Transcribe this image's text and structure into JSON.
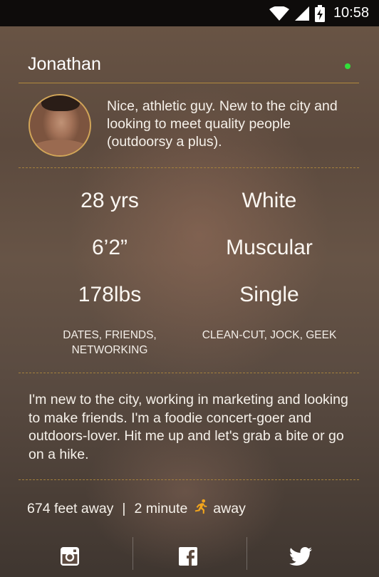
{
  "status_bar": {
    "time": "10:58"
  },
  "profile": {
    "name": "Jonathan",
    "online": true,
    "short_bio": "Nice, athletic guy.  New to the city and looking to meet quality people (outdoorsy a plus)."
  },
  "stats": {
    "age": "28 yrs",
    "ethnicity": "White",
    "height": "6’2”",
    "body_type": "Muscular",
    "weight": "178lbs",
    "relationship": "Single",
    "looking_for": "DATES, FRIENDS, NETWORKING",
    "tribes": "CLEAN-CUT, JOCK, GEEK"
  },
  "about": "I'm new to the city, working in marketing and looking to make friends.  I'm a foodie concert-goer and outdoors-lover.  Hit me up and let's grab a bite or go on a hike.",
  "distance": {
    "feet": "674 feet away",
    "separator": "|",
    "walk_time": "2 minute",
    "walk_suffix": "away"
  },
  "icons": {
    "runner": "running-person-icon",
    "instagram": "instagram-icon",
    "facebook": "facebook-icon",
    "twitter": "twitter-icon"
  },
  "colors": {
    "accent": "#d1a558",
    "online": "#32e03a",
    "runner": "#f2a51c"
  }
}
